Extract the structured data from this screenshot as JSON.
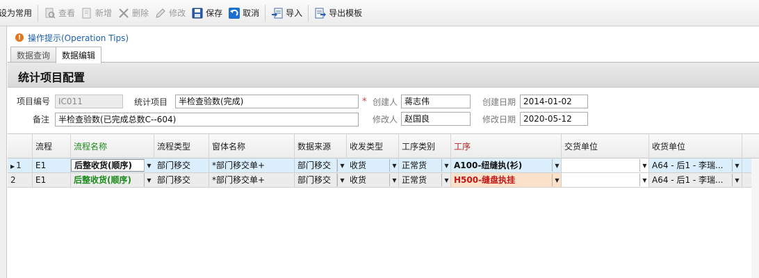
{
  "toolbar": {
    "set_common": "设为常用",
    "view": "查看",
    "add": "新增",
    "delete": "删除",
    "edit": "修改",
    "save": "保存",
    "cancel": "取消",
    "import": "导入",
    "export_template": "导出模板"
  },
  "tips": {
    "icon": "!",
    "text": "操作提示(Operation Tips)"
  },
  "tabs": [
    {
      "label": "数据查询",
      "active": false
    },
    {
      "label": "数据编辑",
      "active": true
    }
  ],
  "page_title": "统计项目配置",
  "form": {
    "item_code_label": "项目编号",
    "item_code_value": "IC011",
    "stat_item_label": "统计项目",
    "stat_item_value": "半检查验数(完成)",
    "required_mark": "*",
    "creator_label": "创建人",
    "creator_value": "蒋志伟",
    "created_date_label": "创建日期",
    "created_date_value": "2014-01-02",
    "remark_label": "备注",
    "remark_value": "半检查验数(已完成总数C--604)",
    "modifier_label": "修改人",
    "modifier_value": "赵国良",
    "modified_date_label": "修改日期",
    "modified_date_value": "2020-05-12"
  },
  "grid": {
    "headers": {
      "flow": "流程",
      "flow_name": "流程名称",
      "flow_type": "流程类型",
      "form_name": "窗体名称",
      "data_source": "数据来源",
      "send_recv_type": "收发类型",
      "process_category": "工序类别",
      "process": "工序",
      "deliver_unit": "交货单位",
      "receive_unit": "收货单位"
    },
    "rows": [
      {
        "index": "1",
        "flow": "E1",
        "flow_name": "后整收货(顺序)",
        "flow_type": "部门移交",
        "form_name": "*部门移交单+",
        "data_source": "部门移交",
        "send_recv_type": "收货",
        "process_category": "正常货",
        "process": "A100-纽缝执(衫)",
        "deliver_unit": "",
        "receive_unit": "A64 - 后1 - 李瑞..."
      },
      {
        "index": "2",
        "flow": "E1",
        "flow_name": "后整收货(顺序)",
        "flow_type": "部门移交",
        "form_name": "*部门移交单+",
        "data_source": "部门移交",
        "send_recv_type": "收货",
        "process_category": "正常货",
        "process": "H500-缝盘执挂",
        "deliver_unit": "",
        "receive_unit": "A64 - 后1 - 李瑞..."
      }
    ]
  },
  "colors": {
    "accent_blue": "#1a5fb4",
    "green_text": "#1a8a1a",
    "red_text": "#c01818",
    "selected_row": "#dbeefb",
    "process_highlight": "#fbe1c9"
  }
}
